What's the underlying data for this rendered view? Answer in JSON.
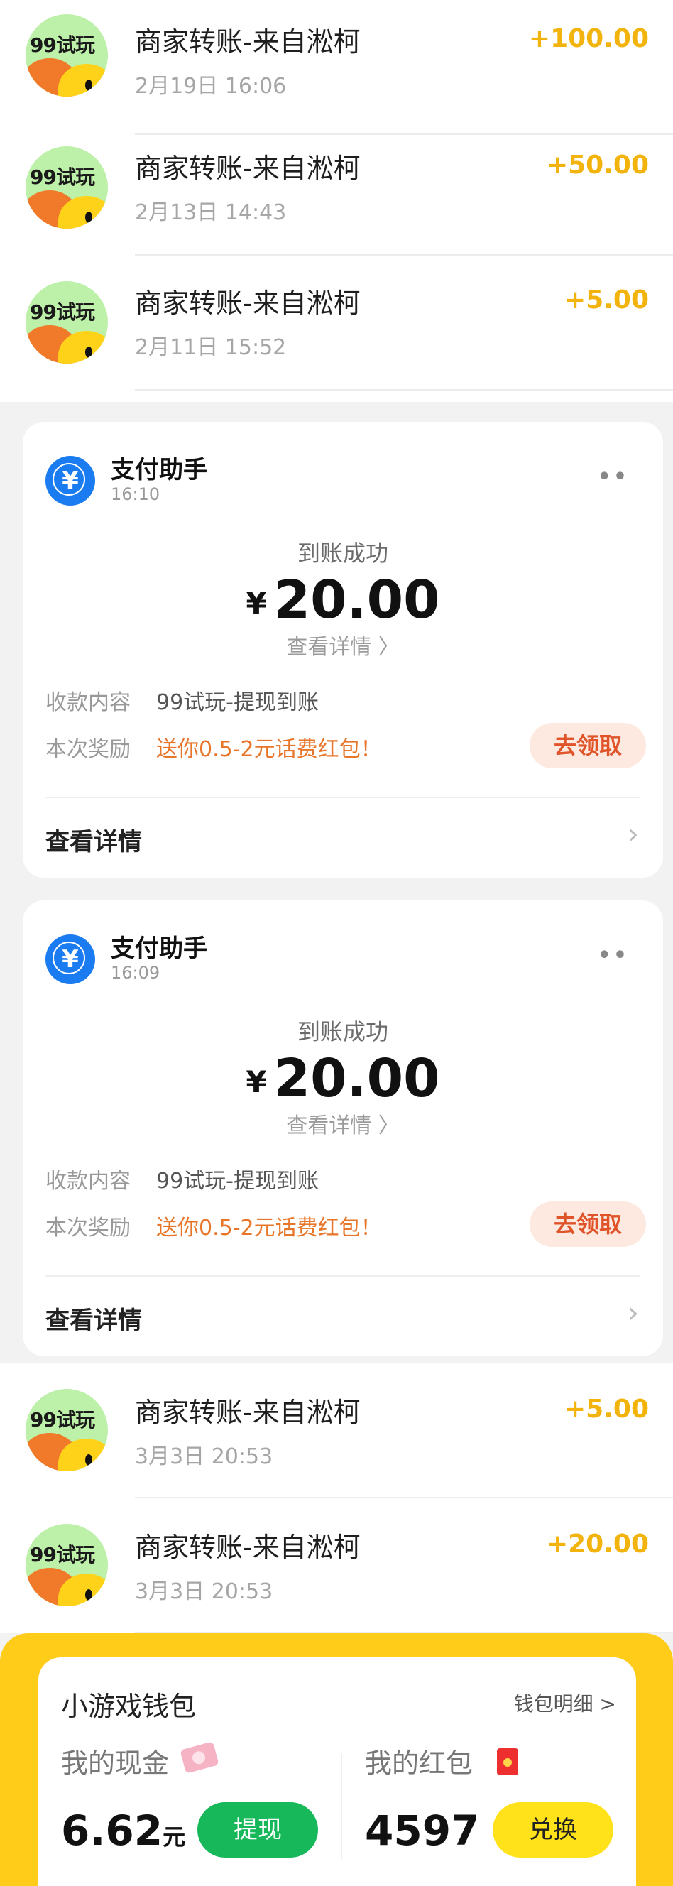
{
  "transfers_top": [
    {
      "avatar_text": "99试玩",
      "title": "商家转账-来自淞柯",
      "time": "2月19日 16:06",
      "amount": "+100.00"
    },
    {
      "avatar_text": "99试玩",
      "title": "商家转账-来自淞柯",
      "time": "2月13日 14:43",
      "amount": "+50.00"
    },
    {
      "avatar_text": "99试玩",
      "title": "商家转账-来自淞柯",
      "time": "2月11日 15:52",
      "amount": "+5.00"
    }
  ],
  "payment_cards": [
    {
      "sender": "支付助手",
      "time": "16:10",
      "status": "到账成功",
      "currency": "¥",
      "amount": "20.00",
      "detail_link": "查看详情 〉",
      "content_label": "收款内容",
      "content_value": "99试玩-提现到账",
      "reward_label": "本次奖励",
      "reward_value": "送你0.5-2元话费红包！",
      "claim_button": "去领取",
      "footer_link": "查看详情"
    },
    {
      "sender": "支付助手",
      "time": "16:09",
      "status": "到账成功",
      "currency": "¥",
      "amount": "20.00",
      "detail_link": "查看详情 〉",
      "content_label": "收款内容",
      "content_value": "99试玩-提现到账",
      "reward_label": "本次奖励",
      "reward_value": "送你0.5-2元话费红包！",
      "claim_button": "去领取",
      "footer_link": "查看详情"
    }
  ],
  "transfers_bottom": [
    {
      "avatar_text": "99试玩",
      "title": "商家转账-来自淞柯",
      "time": "3月3日 20:53",
      "amount": "+5.00"
    },
    {
      "avatar_text": "99试玩",
      "title": "商家转账-来自淞柯",
      "time": "3月3日 20:53",
      "amount": "+20.00"
    }
  ],
  "wallet": {
    "title": "小游戏钱包",
    "detail_link": "钱包明细 >",
    "cash_label": "我的现金",
    "cash_value": "6.62",
    "cash_unit": "元",
    "withdraw_button": "提现",
    "redpack_label": "我的红包",
    "redpack_value": "4597",
    "exchange_button": "兑换"
  },
  "colors": {
    "amount": "#f2b30c",
    "promo": "#e8762a",
    "wallet_band": "#ffcc1a",
    "withdraw": "#16b85a",
    "pay_icon": "#1a7cf0"
  }
}
